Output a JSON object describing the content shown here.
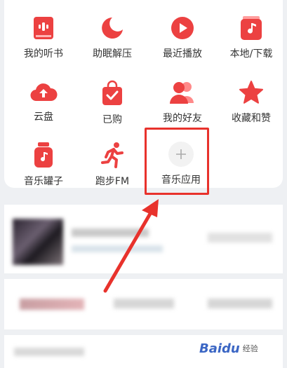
{
  "grid": {
    "items": [
      {
        "label": "我的听书",
        "icon": "audiobook-icon"
      },
      {
        "label": "助眠解压",
        "icon": "moon-sleep-icon"
      },
      {
        "label": "最近播放",
        "icon": "play-circle-icon"
      },
      {
        "label": "本地/下载",
        "icon": "music-folder-icon"
      },
      {
        "label": "云盘",
        "icon": "cloud-upload-icon"
      },
      {
        "label": "已购",
        "icon": "shopping-bag-icon"
      },
      {
        "label": "我的好友",
        "icon": "friends-icon"
      },
      {
        "label": "收藏和赞",
        "icon": "star-icon"
      },
      {
        "label": "音乐罐子",
        "icon": "music-jar-icon"
      },
      {
        "label": "跑步FM",
        "icon": "running-icon"
      },
      {
        "label": "音乐应用",
        "icon": "plus-icon"
      }
    ]
  },
  "colors": {
    "accent": "#ec4141",
    "highlight_box": "#e8322c",
    "background": "#eef0f3"
  },
  "watermark": {
    "brand": "Baidu",
    "sub": "经验"
  }
}
